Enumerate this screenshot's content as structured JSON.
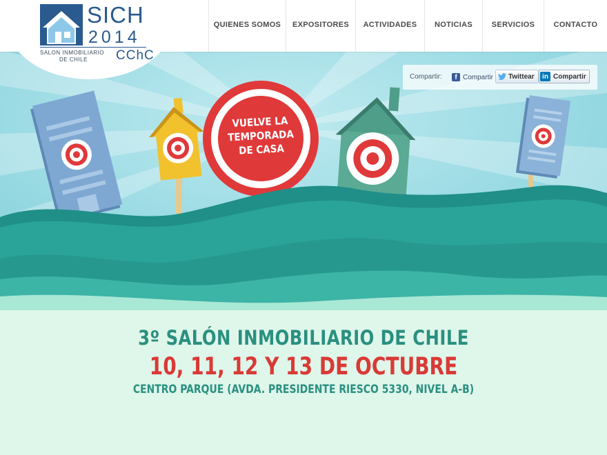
{
  "brand": {
    "name": "SICH",
    "year": "2014",
    "subtitle_line1": "SALON INMOBILIARIO",
    "subtitle_line2": "DE CHILE",
    "partner": "CChC",
    "color": "#2a5a8e"
  },
  "nav": {
    "items": [
      {
        "label": "QUIENES SOMOS"
      },
      {
        "label": "EXPOSITORES"
      },
      {
        "label": "ACTIVIDADES"
      },
      {
        "label": "NOTICIAS"
      },
      {
        "label": "SERVICIOS"
      },
      {
        "label": "CONTACTO"
      }
    ]
  },
  "share": {
    "label": "Compartir:",
    "facebook_label": "Compartir",
    "twitter_label": "Twittear",
    "linkedin_label": "Compartir",
    "icons": [
      "facebook-icon",
      "twitter-icon",
      "linkedin-icon"
    ]
  },
  "hero": {
    "badge_line1": "VUELVE LA",
    "badge_line2": "TEMPORADA",
    "badge_line3": "DE CASA",
    "colors": {
      "sky": "#7fd0da",
      "sea": "#2fa89c",
      "badge": "#e0393a",
      "yellow_house": "#f2c12e",
      "green_house": "#4e9e8a",
      "building": "#6e9cc4"
    }
  },
  "event": {
    "title": "3º SALÓN INMOBILIARIO DE CHILE",
    "dates": "10, 11, 12 Y 13 DE OCTUBRE",
    "venue": "CENTRO PARQUE (AVDA. PRESIDENTE RIESCO 5330, NIVEL A-B)",
    "colors": {
      "title": "#2a9080",
      "dates": "#d93a36"
    }
  }
}
